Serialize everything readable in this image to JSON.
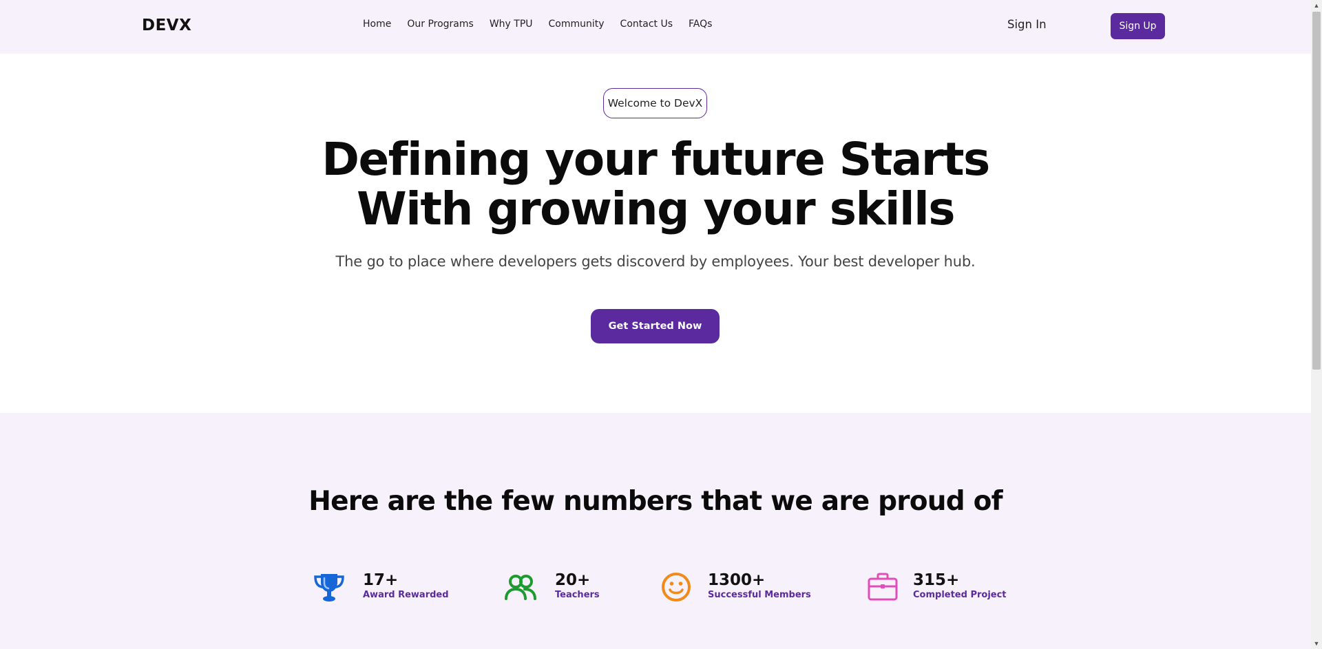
{
  "navbar": {
    "logo": "DEVX",
    "links": [
      "Home",
      "Our Programs",
      "Why TPU",
      "Community",
      "Contact Us",
      "FAQs"
    ],
    "sign_in": "Sign In",
    "sign_up": "Sign Up"
  },
  "hero": {
    "badge": "Welcome to DevX",
    "title_line1": "Defining your future Starts",
    "title_line2": "With growing your skills",
    "subtitle": "The go to place where developers gets discoverd by employees. Your best developer hub.",
    "cta": "Get Started Now"
  },
  "stats": {
    "heading": "Here are the few numbers that we are proud of",
    "items": [
      {
        "value": "17+",
        "label": "Award Rewarded",
        "icon": "trophy-icon",
        "color": "#1766d8"
      },
      {
        "value": "20+",
        "label": "Teachers",
        "icon": "users-icon",
        "color": "#1e9b2e"
      },
      {
        "value": "1300+",
        "label": "Successful Members",
        "icon": "smile-icon",
        "color": "#f28a1a"
      },
      {
        "value": "315+",
        "label": "Completed Project",
        "icon": "briefcase-icon",
        "color": "#e14db8"
      }
    ]
  },
  "colors": {
    "accent": "#5b2a9e",
    "nav_background": "#f7f1fc"
  }
}
